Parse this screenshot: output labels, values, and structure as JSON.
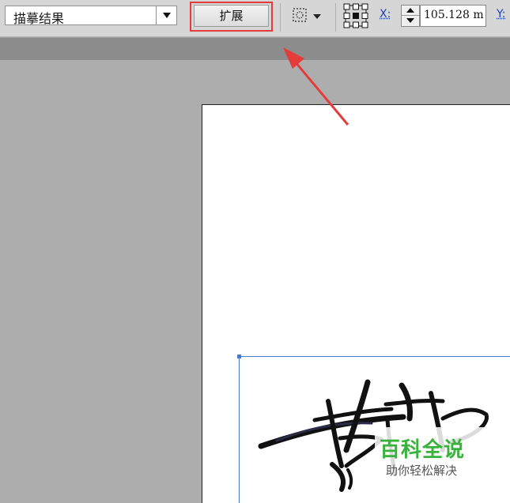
{
  "toolbar": {
    "trace_result_dropdown": "描摹结果",
    "expand_button": "扩展",
    "x_label": "X:",
    "x_value": "105.128 m",
    "y_label": "Y:"
  },
  "colors": {
    "highlight": "#e43b3b",
    "axis_label": "#1c3fb8",
    "selection": "#4a79c9",
    "watermark_green": "#38b23b"
  },
  "watermark": {
    "title": "百科全说",
    "subtitle": "助你轻松解决"
  },
  "icons": {
    "select_tool": "dashed-selection-icon",
    "transform": "transform-grid-icon",
    "pointer": "red-arrow-annotation"
  }
}
